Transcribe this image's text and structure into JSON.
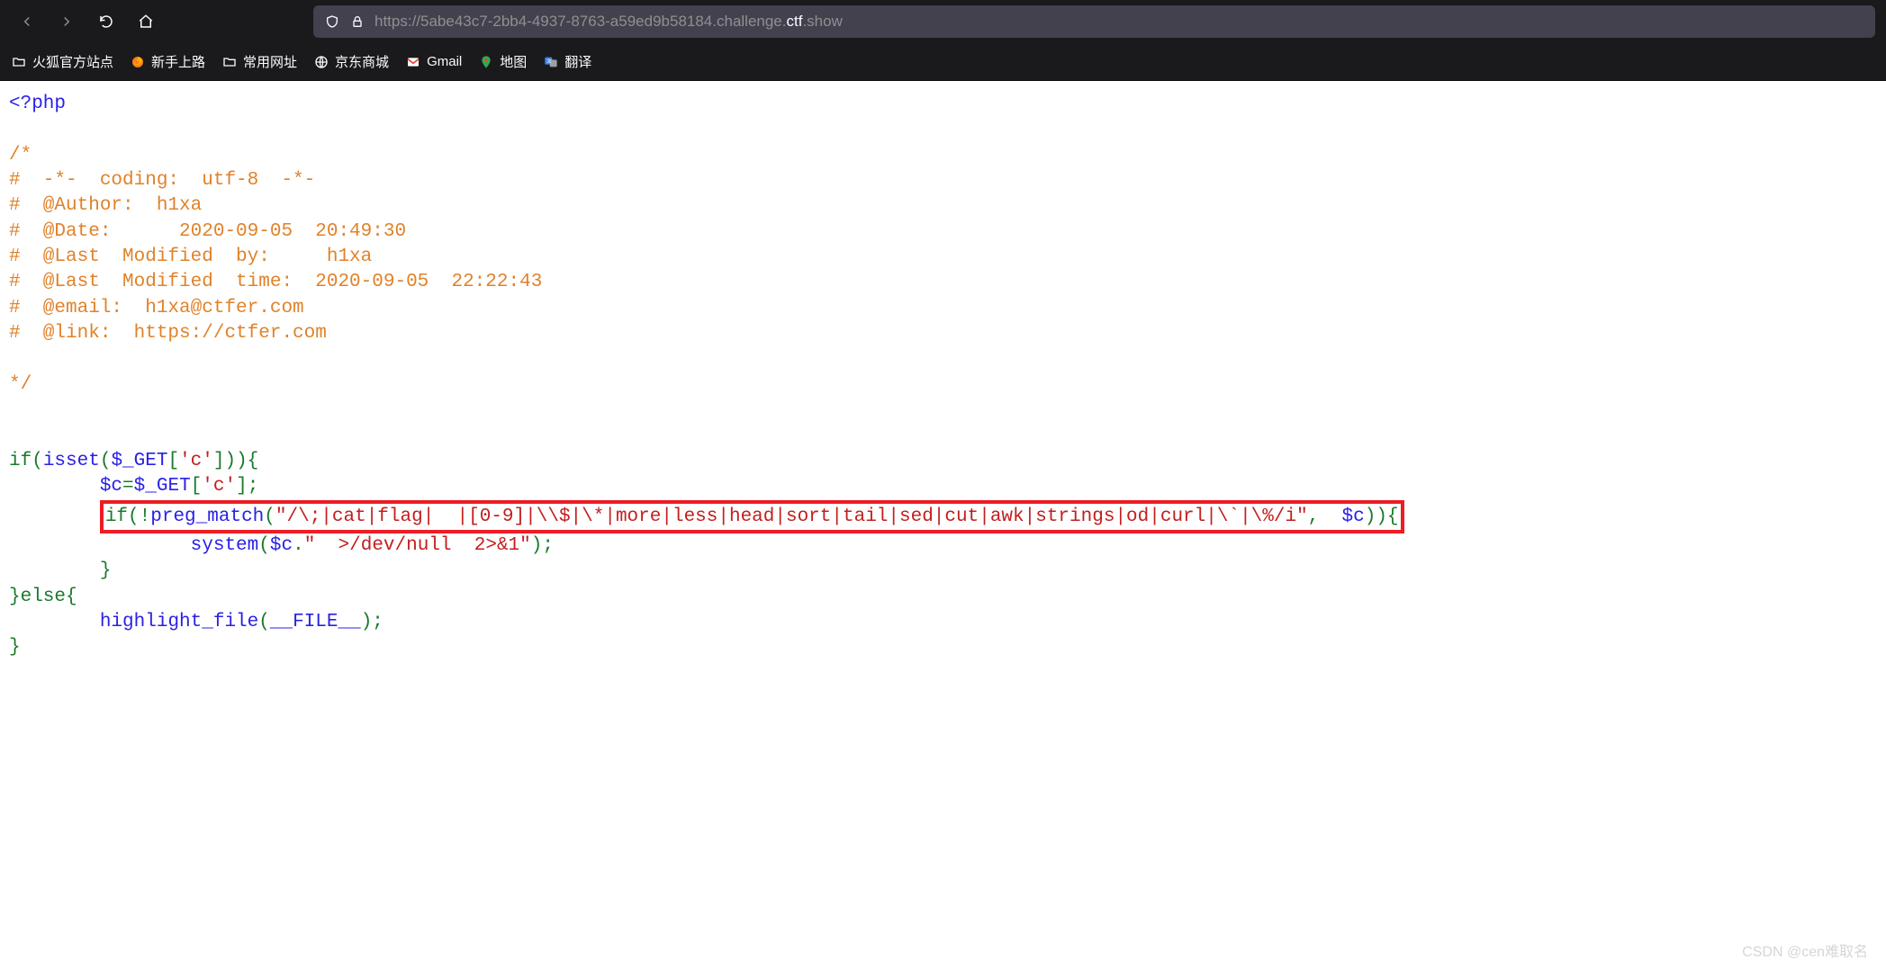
{
  "nav": {
    "url_prefix": "https://5abe43c7-2bb4-4937-8763-a59ed9b58184.challenge.",
    "url_domain": "ctf",
    "url_suffix": ".show"
  },
  "bookmarks": [
    {
      "label": "火狐官方站点",
      "icon": "folder"
    },
    {
      "label": "新手上路",
      "icon": "firefox"
    },
    {
      "label": "常用网址",
      "icon": "folder"
    },
    {
      "label": "京东商城",
      "icon": "globe"
    },
    {
      "label": "Gmail",
      "icon": "gmail"
    },
    {
      "label": "地图",
      "icon": "gmaps"
    },
    {
      "label": "翻译",
      "icon": "gtrans"
    }
  ],
  "code": {
    "open_tag": "<?php",
    "comment_block": "/*\n#  -*-  coding:  utf-8  -*-\n#  @Author:  h1xa\n#  @Date:      2020-09-05  20:49:30\n#  @Last  Modified  by:     h1xa\n#  @Last  Modified  time:  2020-09-05  22:22:43\n#  @email:  h1xa@ctfer.com\n#  @link:  https://ctfer.com\n\n*/",
    "line_if_isset_pre": "if(",
    "line_if_isset_fn": "isset",
    "line_if_isset_mid1": "(",
    "line_if_isset_var": "$_GET",
    "line_if_isset_mid2": "[",
    "line_if_isset_str": "'c'",
    "line_if_isset_post": "])){",
    "line_assign_var1": "$c",
    "line_assign_eq": "=",
    "line_assign_var2": "$_GET",
    "line_assign_mid": "[",
    "line_assign_str": "'c'",
    "line_assign_end": "];",
    "red_if": "if(!",
    "red_fn": "preg_match",
    "red_p1": "(",
    "red_regex": "\"/\\;|cat|flag|  |[0-9]|\\\\$|\\*|more|less|head|sort|tail|sed|cut|awk|strings|od|curl|\\`|\\%/i\"",
    "red_comma": ",  ",
    "red_var": "$c",
    "red_p2": ")){",
    "sys_fn": "system",
    "sys_p1": "(",
    "sys_var": "$c",
    "sys_dot": ".",
    "sys_str": "\"  >/dev/null  2>&1\"",
    "sys_end": ");",
    "brace1": "}",
    "else_txt": "}else{",
    "hl_fn": "highlight_file",
    "hl_p1": "(",
    "hl_arg": "__FILE__",
    "hl_end": ");",
    "brace2": "}"
  },
  "watermark": "CSDN @cen难取名"
}
